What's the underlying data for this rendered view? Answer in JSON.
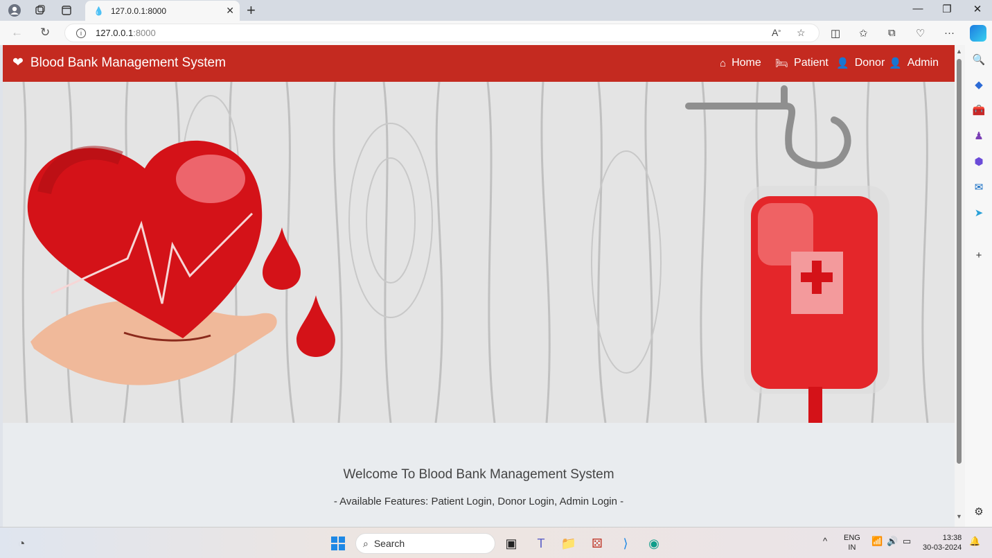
{
  "browser": {
    "tab_title": "127.0.0.1:8000",
    "url_host": "127.0.0.1",
    "url_port": ":8000"
  },
  "navbar": {
    "brand": "Blood Bank Management System",
    "links": [
      "Home",
      "Patient",
      "Donor",
      "Admin"
    ]
  },
  "main": {
    "welcome": "Welcome To Blood Bank Management System",
    "features": "- Available Features: Patient Login, Donor Login, Admin Login -"
  },
  "taskbar": {
    "search_label": "Search",
    "lang_top": "ENG",
    "lang_bottom": "IN",
    "time": "13:38",
    "date": "30-03-2024"
  },
  "colors": {
    "navbar": "#c42a20",
    "blood_red": "#d41218",
    "page_bg": "#e9ecef"
  }
}
